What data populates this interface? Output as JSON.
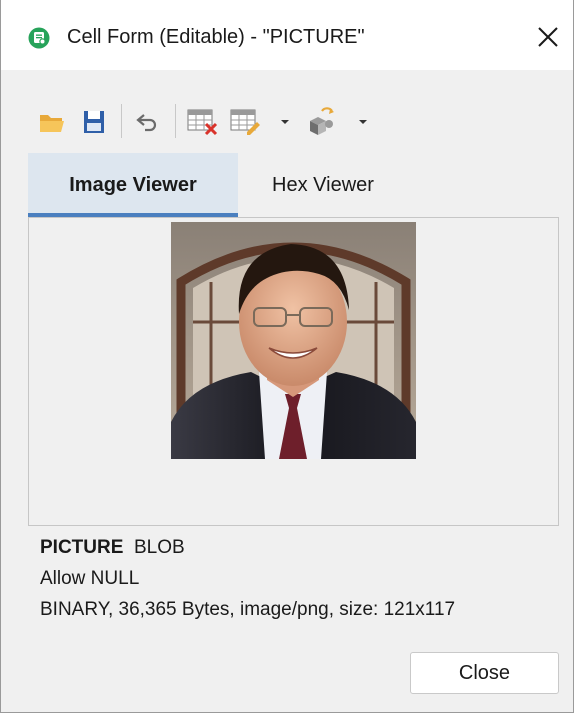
{
  "window": {
    "title": "Cell Form (Editable) - \"PICTURE\"",
    "accent_color": "#27a35a"
  },
  "toolbar": {
    "buttons": [
      {
        "icon": "folder-open-icon"
      },
      {
        "icon": "save-icon"
      },
      {
        "icon": "undo-icon"
      },
      {
        "icon": "clear-cell-icon"
      },
      {
        "icon": "edit-cell-icon"
      },
      {
        "icon": "dropdown-arrow-icon"
      },
      {
        "icon": "shapes-icon"
      },
      {
        "icon": "dropdown-arrow-icon"
      }
    ]
  },
  "tabs": [
    {
      "label": "Image Viewer",
      "active": true
    },
    {
      "label": "Hex Viewer",
      "active": false
    }
  ],
  "field": {
    "name": "PICTURE",
    "type": "BLOB",
    "nullability": "Allow NULL",
    "details": "BINARY, 36,365 Bytes, image/png, size: 121x117"
  },
  "buttons": {
    "close_label": "Close"
  }
}
